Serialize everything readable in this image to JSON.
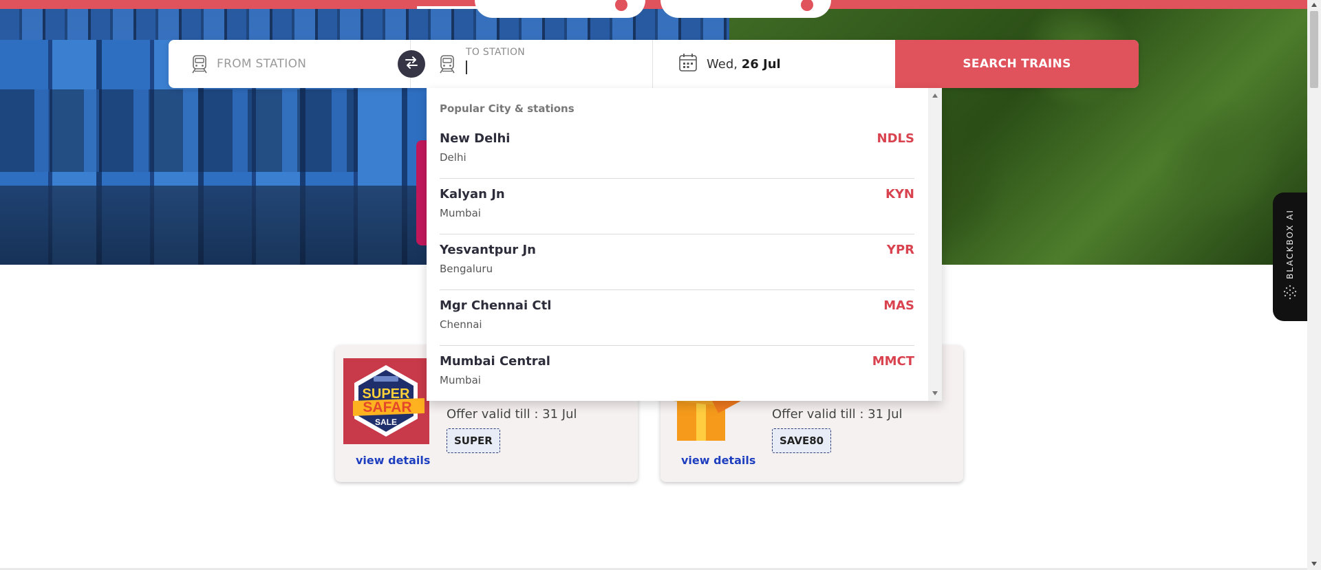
{
  "search": {
    "from_placeholder": "FROM STATION",
    "to_label": "TO STATION",
    "to_value": "",
    "date_day": "Wed,",
    "date_value": "26 Jul",
    "search_button": "SEARCH TRAINS"
  },
  "dropdown": {
    "heading": "Popular City & stations",
    "items": [
      {
        "name": "New Delhi",
        "city": "Delhi",
        "code": "NDLS"
      },
      {
        "name": "Kalyan Jn",
        "city": "Mumbai",
        "code": "KYN"
      },
      {
        "name": "Yesvantpur Jn",
        "city": "Bengaluru",
        "code": "YPR"
      },
      {
        "name": "Mgr Chennai Ctl",
        "city": "Chennai",
        "code": "MAS"
      },
      {
        "name": "Mumbai Central",
        "city": "Mumbai",
        "code": "MMCT"
      }
    ]
  },
  "offers": [
    {
      "valid": "Offer valid till : 31 Jul",
      "code": "SUPER",
      "details": "view details",
      "badge_top": "SUPER",
      "badge_mid": "SAFAR",
      "badge_bottom": "SALE"
    },
    {
      "valid": "Offer valid till : 31 Jul",
      "code": "SAVE80",
      "details": "view details"
    }
  ],
  "widget": {
    "label": "BLACKBOX AI"
  },
  "colors": {
    "accent": "#e0525c",
    "code_red": "#d9434f",
    "link_blue": "#1d3fbf",
    "swap_bg": "#353546"
  },
  "icons": {
    "from": "train-icon",
    "to": "train-icon",
    "swap": "swap-arrows-icon",
    "date": "calendar-icon"
  }
}
